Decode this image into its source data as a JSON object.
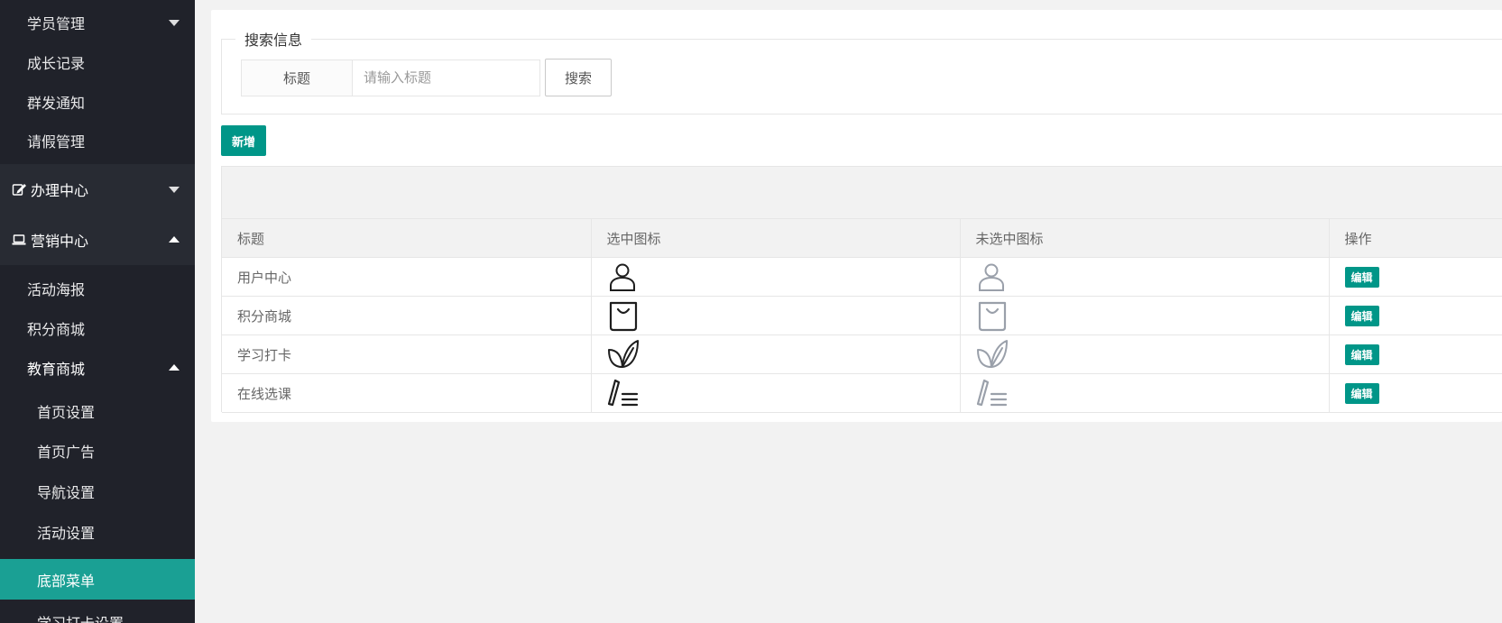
{
  "sidebar": {
    "items": [
      {
        "label": "学员管理"
      },
      {
        "label": "成长记录"
      },
      {
        "label": "群发通知"
      },
      {
        "label": "请假管理"
      },
      {
        "label": "办理中心"
      },
      {
        "label": "营销中心"
      },
      {
        "label": "活动海报"
      },
      {
        "label": "积分商城"
      },
      {
        "label": "教育商城"
      },
      {
        "label": "首页设置"
      },
      {
        "label": "首页广告"
      },
      {
        "label": "导航设置"
      },
      {
        "label": "活动设置"
      },
      {
        "label": "底部菜单"
      },
      {
        "label": "学习打卡设置"
      }
    ],
    "active_color": "#1aa094"
  },
  "search": {
    "legend": "搜索信息",
    "field_label": "标题",
    "placeholder": "请输入标题",
    "value": "",
    "button": "搜索"
  },
  "toolbar": {
    "add_label": "新增",
    "accent": "#009688"
  },
  "table": {
    "columns": [
      "标题",
      "选中图标",
      "未选中图标",
      "操作"
    ],
    "rows": [
      {
        "title": "用户中心",
        "icon": "user-icon",
        "action": "编辑"
      },
      {
        "title": "积分商城",
        "icon": "shopping-bag-icon",
        "action": "编辑"
      },
      {
        "title": "学习打卡",
        "icon": "leaf-icon",
        "action": "编辑"
      },
      {
        "title": "在线选课",
        "icon": "course-list-icon",
        "action": "编辑"
      }
    ],
    "selected_icon_color": "#1e1e1e",
    "unselected_icon_color": "#9aa0aa"
  }
}
